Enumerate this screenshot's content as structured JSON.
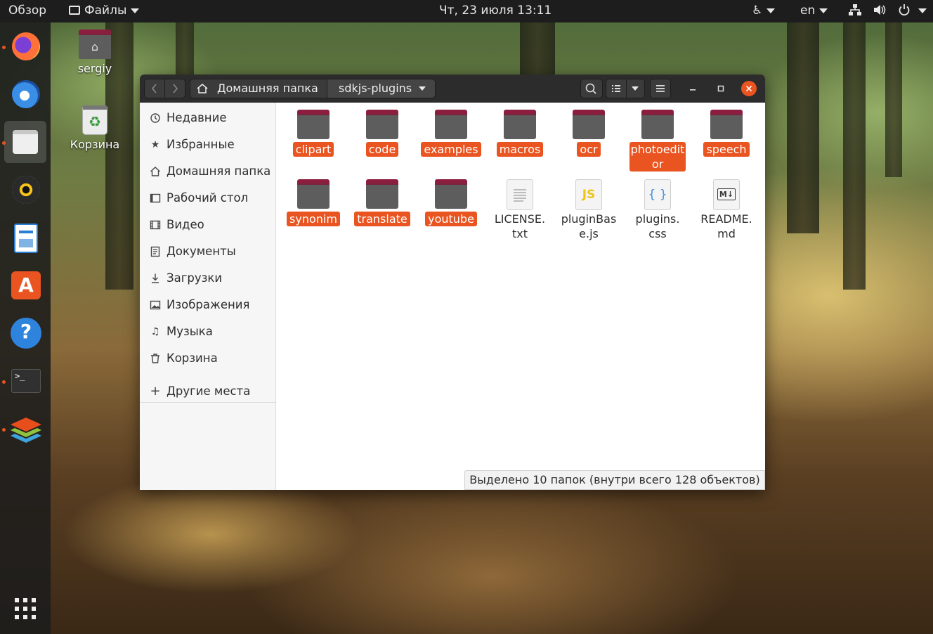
{
  "topbar": {
    "activities": "Обзор",
    "app_menu": "Файлы",
    "clock": "Чт, 23 июля  13:11",
    "keyboard_layout": "en"
  },
  "dock": {
    "items": [
      {
        "name": "firefox",
        "running": true
      },
      {
        "name": "thunderbird",
        "running": false
      },
      {
        "name": "files",
        "running": true,
        "active": true
      },
      {
        "name": "rhythmbox",
        "running": false
      },
      {
        "name": "libreoffice-writer",
        "running": false
      },
      {
        "name": "ubuntu-software",
        "running": false
      },
      {
        "name": "help",
        "running": false
      },
      {
        "name": "terminal",
        "running": true
      },
      {
        "name": "onlyoffice",
        "running": true
      }
    ]
  },
  "desktop": {
    "icons": [
      {
        "label": "sergiy",
        "icon": "home-folder-icon"
      },
      {
        "label": "Корзина",
        "icon": "trash-icon"
      }
    ]
  },
  "window": {
    "path": [
      "Домашняя папка",
      "sdkjs-plugins"
    ],
    "sidebar": [
      {
        "label": "Недавние",
        "icon": "clock-icon"
      },
      {
        "label": "Избранные",
        "icon": "star-icon"
      },
      {
        "label": "Домашняя папка",
        "icon": "home-icon"
      },
      {
        "label": "Рабочий стол",
        "icon": "desktop-icon"
      },
      {
        "label": "Видео",
        "icon": "video-icon"
      },
      {
        "label": "Документы",
        "icon": "document-icon"
      },
      {
        "label": "Загрузки",
        "icon": "download-icon"
      },
      {
        "label": "Изображения",
        "icon": "image-icon"
      },
      {
        "label": "Музыка",
        "icon": "music-icon"
      },
      {
        "label": "Корзина",
        "icon": "trash-icon"
      },
      {
        "label": "Другие места",
        "icon": "plus-icon"
      }
    ],
    "items": [
      {
        "label": "clipart",
        "type": "folder",
        "selected": true
      },
      {
        "label": "code",
        "type": "folder",
        "selected": true
      },
      {
        "label": "examples",
        "type": "folder",
        "selected": true
      },
      {
        "label": "macros",
        "type": "folder",
        "selected": true
      },
      {
        "label": "ocr",
        "type": "folder",
        "selected": true
      },
      {
        "label": "photoeditor",
        "label_lines": [
          "photoedit",
          "or"
        ],
        "type": "folder",
        "selected": true
      },
      {
        "label": "speech",
        "type": "folder",
        "selected": true
      },
      {
        "label": "synonim",
        "type": "folder",
        "selected": true
      },
      {
        "label": "translate",
        "type": "folder",
        "selected": true
      },
      {
        "label": "youtube",
        "type": "folder",
        "selected": true
      },
      {
        "label": "LICENSE.txt",
        "label_lines": [
          "LICENSE.",
          "txt"
        ],
        "type": "text-file",
        "selected": false
      },
      {
        "label": "pluginBase.js",
        "label_lines": [
          "pluginBas",
          "e.js"
        ],
        "type": "js-file",
        "icon_text": "JS",
        "selected": false
      },
      {
        "label": "plugins.css",
        "label_lines": [
          "plugins.",
          "css"
        ],
        "type": "css-file",
        "icon_text": "{ }",
        "selected": false
      },
      {
        "label": "README.md",
        "label_lines": [
          "README.",
          "md"
        ],
        "type": "markdown-file",
        "icon_text": "M↓",
        "selected": false
      }
    ],
    "status": "Выделено 10 папок (внутри всего 128 объектов)"
  },
  "colors": {
    "accent": "#e95420",
    "folder_tab": "#8b1e3f",
    "folder_body": "#5d5d5d",
    "topbar": "#1d1d1d",
    "headerbar": "#2c2c2c"
  }
}
